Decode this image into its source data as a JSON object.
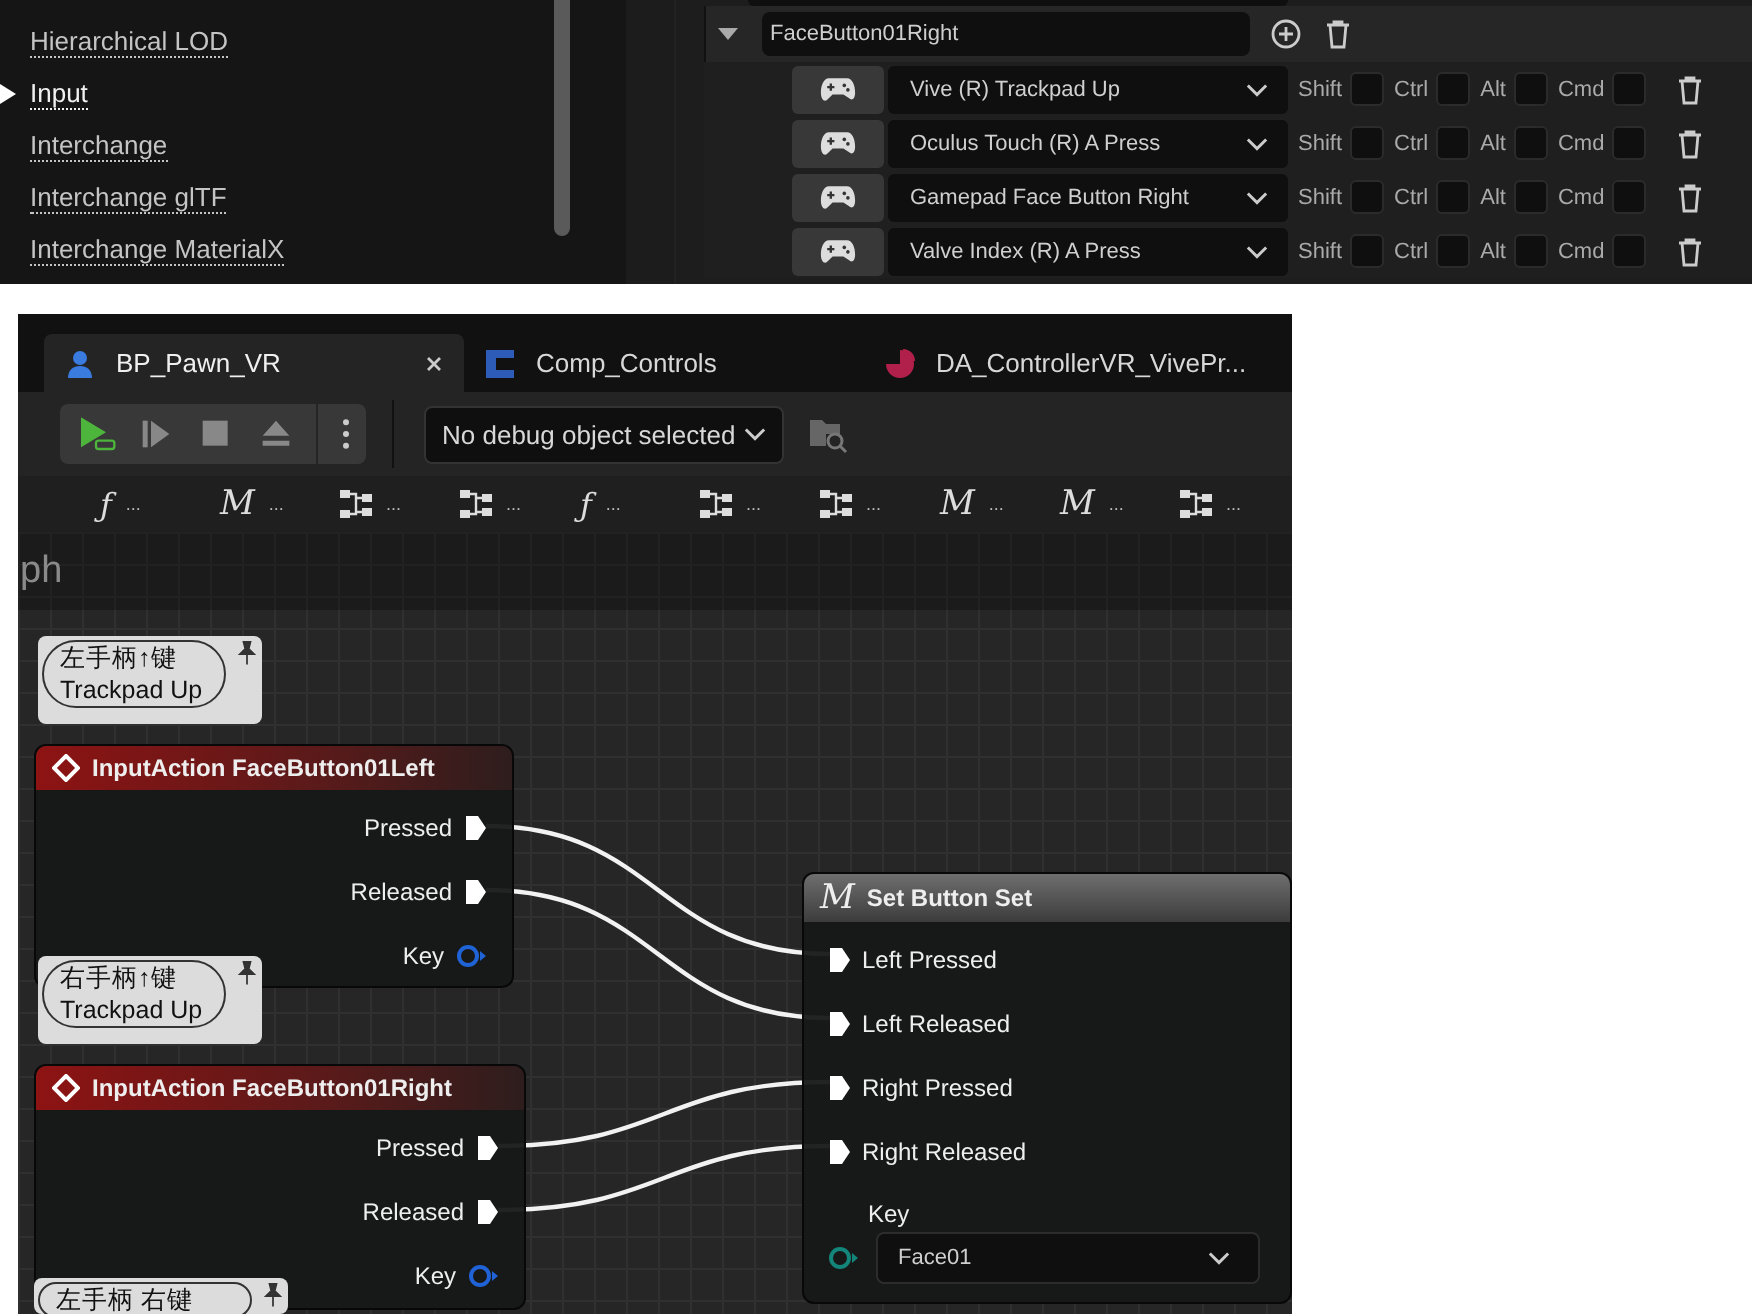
{
  "settings_list": {
    "items": [
      {
        "label": "Hierarchical LOD",
        "selected": false
      },
      {
        "label": "Input",
        "selected": true
      },
      {
        "label": "Interchange",
        "selected": false
      },
      {
        "label": "Interchange glTF",
        "selected": false
      },
      {
        "label": "Interchange MaterialX",
        "selected": false
      }
    ]
  },
  "action_mappings": {
    "action": {
      "name": "FaceButton01Right",
      "expanded": true
    },
    "mappings": [
      {
        "key": "Vive (R) Trackpad Up",
        "modifiers": [
          {
            "label": "Shift",
            "checked": false
          },
          {
            "label": "Ctrl",
            "checked": false
          },
          {
            "label": "Alt",
            "checked": false
          },
          {
            "label": "Cmd",
            "checked": false
          }
        ]
      },
      {
        "key": "Oculus Touch (R) A Press",
        "modifiers": [
          {
            "label": "Shift",
            "checked": false
          },
          {
            "label": "Ctrl",
            "checked": false
          },
          {
            "label": "Alt",
            "checked": false
          },
          {
            "label": "Cmd",
            "checked": false
          }
        ]
      },
      {
        "key": "Gamepad Face Button Right",
        "modifiers": [
          {
            "label": "Shift",
            "checked": false
          },
          {
            "label": "Ctrl",
            "checked": false
          },
          {
            "label": "Alt",
            "checked": false
          },
          {
            "label": "Cmd",
            "checked": false
          }
        ]
      },
      {
        "key": "Valve Index (R) A Press",
        "modifiers": [
          {
            "label": "Shift",
            "checked": false
          },
          {
            "label": "Ctrl",
            "checked": false
          },
          {
            "label": "Alt",
            "checked": false
          },
          {
            "label": "Cmd",
            "checked": false
          }
        ]
      }
    ]
  },
  "editor": {
    "tabs": [
      {
        "label": "BP_Pawn_VR",
        "kind": "pawn",
        "selected": true
      },
      {
        "label": "Comp_Controls",
        "kind": "component",
        "selected": false
      },
      {
        "label": "DA_ControllerVR_VivePr...",
        "kind": "data_asset",
        "selected": false
      }
    ],
    "debug_dropdown": {
      "value": "No debug object selected"
    },
    "graph_tabs": [
      {
        "kind": "function",
        "glyph": "ƒ",
        "label": "..."
      },
      {
        "kind": "macro",
        "glyph": "M",
        "label": "..."
      },
      {
        "kind": "graph",
        "label": "..."
      },
      {
        "kind": "graph",
        "label": "..."
      },
      {
        "kind": "function",
        "glyph": "ƒ",
        "label": "..."
      },
      {
        "kind": "graph",
        "label": "..."
      },
      {
        "kind": "graph",
        "label": "..."
      },
      {
        "kind": "macro",
        "glyph": "M",
        "label": "..."
      },
      {
        "kind": "macro",
        "glyph": "M",
        "label": "..."
      },
      {
        "kind": "graph",
        "label": "..."
      }
    ],
    "graph": {
      "title": "ph",
      "comments": [
        {
          "text": "左手柄↑键\nTrackpad Up"
        },
        {
          "text": "右手柄↑键\nTrackpad Up"
        },
        {
          "text": "左手柄 右键"
        }
      ],
      "nodes": [
        {
          "kind": "event",
          "title": "InputAction FaceButton01Left",
          "pins": [
            {
              "kind": "exec",
              "label": "Pressed"
            },
            {
              "kind": "exec",
              "label": "Released"
            },
            {
              "kind": "data",
              "label": "Key"
            }
          ]
        },
        {
          "kind": "event",
          "title": "InputAction FaceButton01Right",
          "pins": [
            {
              "kind": "exec",
              "label": "Pressed"
            },
            {
              "kind": "exec",
              "label": "Released"
            },
            {
              "kind": "data",
              "label": "Key"
            }
          ]
        },
        {
          "kind": "function",
          "glyph": "M",
          "title": "Set Button Set",
          "pins": [
            {
              "kind": "exec",
              "label": "Left Pressed"
            },
            {
              "kind": "exec",
              "label": "Left Released"
            },
            {
              "kind": "exec",
              "label": "Right Pressed"
            },
            {
              "kind": "exec",
              "label": "Right Released"
            },
            {
              "kind": "select",
              "label": "Key",
              "value": "Face01"
            }
          ]
        }
      ]
    }
  }
}
